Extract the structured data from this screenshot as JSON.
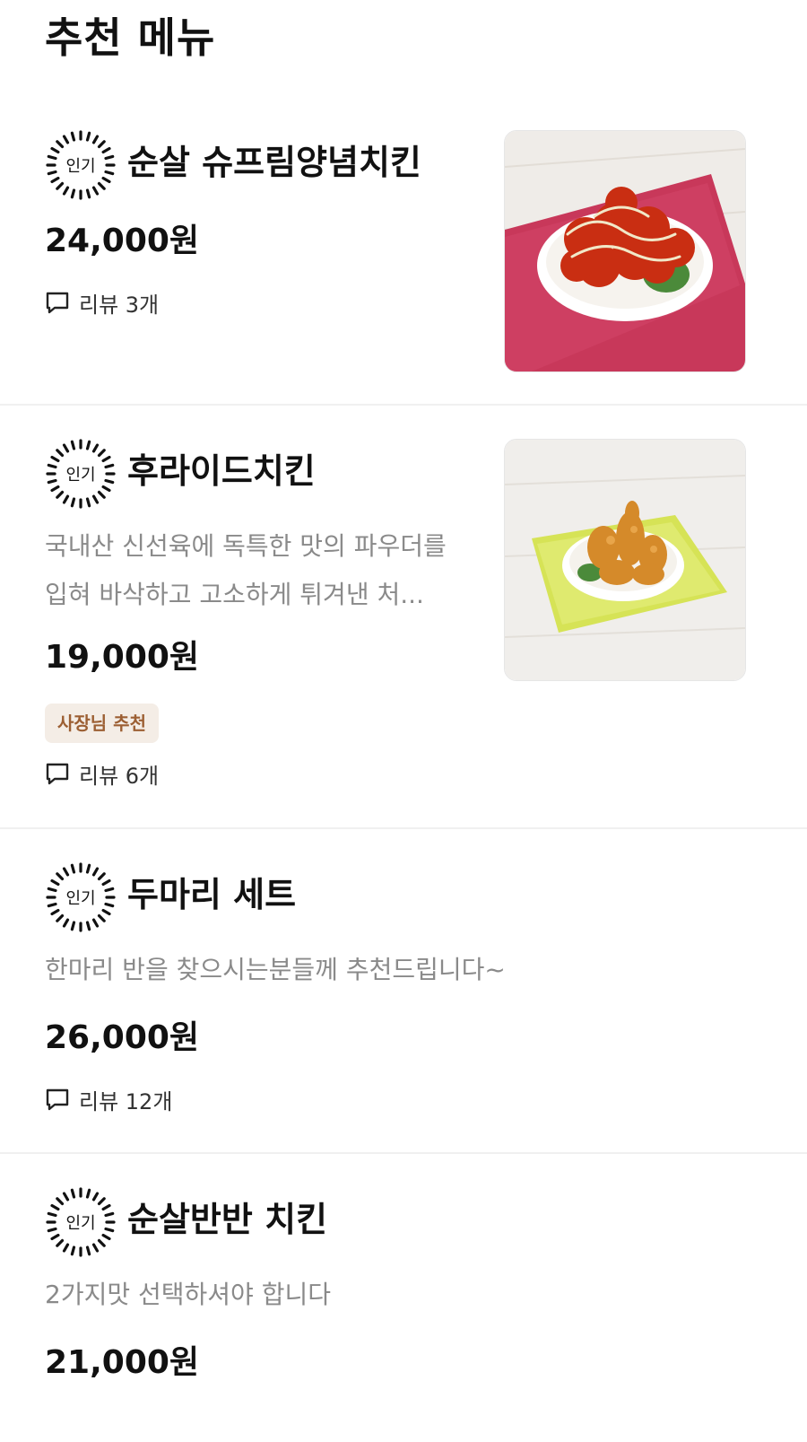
{
  "page": {
    "section_title": "추천 메뉴"
  },
  "badge": {
    "popular_label": "인기"
  },
  "menu": [
    {
      "name": "순살 슈프림양념치킨",
      "description": "",
      "price": "24,000원",
      "owner_badge": "",
      "review_text": "리뷰 3개",
      "image": "supreme-seasoned-chicken-photo"
    },
    {
      "name": "후라이드치킨",
      "description_line1": "국내산 신선육에 독특한 맛의 파우더를",
      "description_line2": "입혀 바삭하고 고소하게 튀겨낸 처...",
      "price": "19,000원",
      "owner_badge": "사장님 추천",
      "review_text": "리뷰 6개",
      "image": "fried-chicken-photo"
    },
    {
      "name": "두마리 세트",
      "description": "한마리 반을 찾으시는분들께  추천드립니다~",
      "price": "26,000원",
      "review_text": "리뷰 12개"
    },
    {
      "name": "순살반반 치킨",
      "description": "2가지맛 선택하셔야 합니다",
      "price": "21,000원"
    }
  ],
  "icons": {
    "review": "speech-bubble-icon",
    "popular": "sunburst-badge-icon"
  },
  "colors": {
    "text_primary": "#111111",
    "text_secondary": "#8a8a8a",
    "owner_badge_bg": "#f4ede6",
    "owner_badge_text": "#9c5f33",
    "divider": "#f0f0f0"
  }
}
